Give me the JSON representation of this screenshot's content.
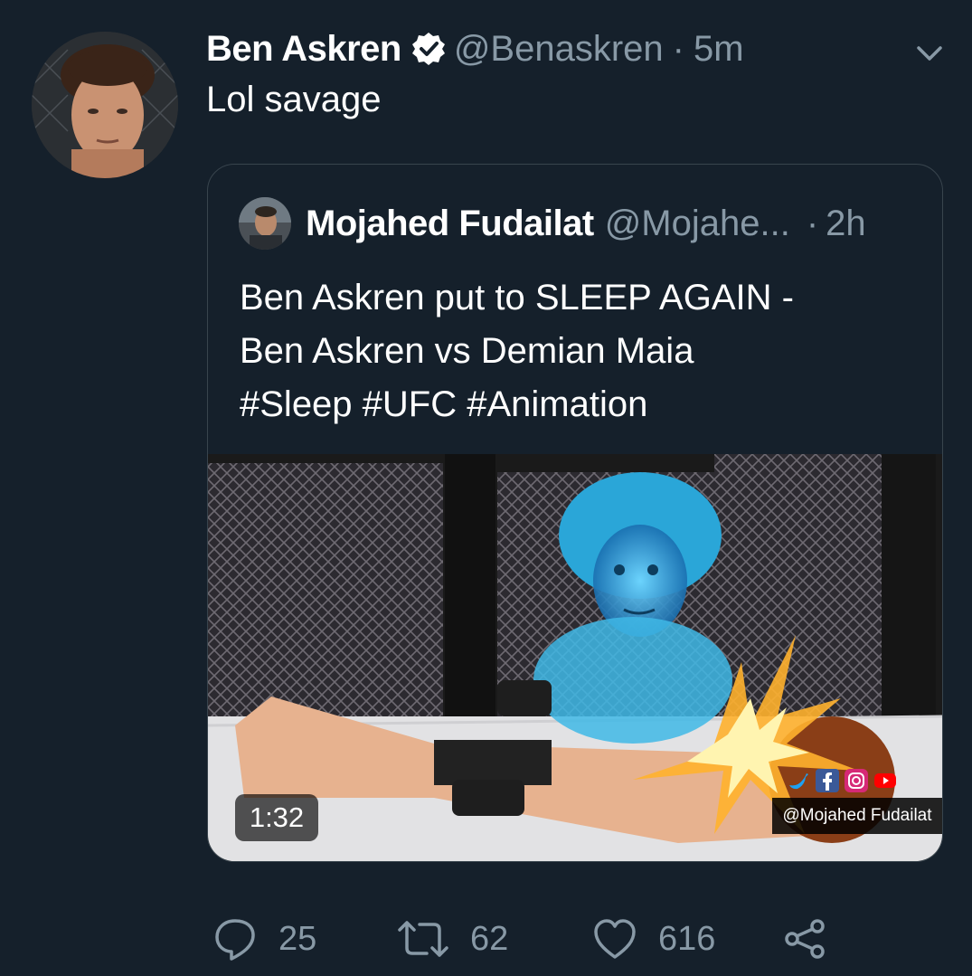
{
  "tweet": {
    "author_name": "Ben Askren",
    "author_handle": "@Benaskren",
    "separator": "·",
    "time": "5m",
    "text": "Lol savage"
  },
  "quoted_tweet": {
    "author_name": "Mojahed Fudailat",
    "author_handle": "@Mojahe...",
    "separator": "·",
    "time": "2h",
    "text_lines": [
      "Ben Askren put to SLEEP AGAIN -",
      "Ben Askren vs Demian Maia",
      "#Sleep #UFC #Animation"
    ],
    "video": {
      "duration": "1:32",
      "watermark": "@Mojahed Fudailat"
    }
  },
  "actions": {
    "reply_count": "25",
    "retweet_count": "62",
    "like_count": "616"
  },
  "colors": {
    "background": "#15202b",
    "secondary_text": "#8899a6",
    "border": "#38444d",
    "verified": "#ffffff"
  },
  "icons": [
    "verified-icon",
    "chevron-down-icon",
    "reply-icon",
    "retweet-icon",
    "like-icon",
    "share-icon",
    "twitter-icon",
    "facebook-icon",
    "instagram-icon",
    "youtube-icon"
  ]
}
